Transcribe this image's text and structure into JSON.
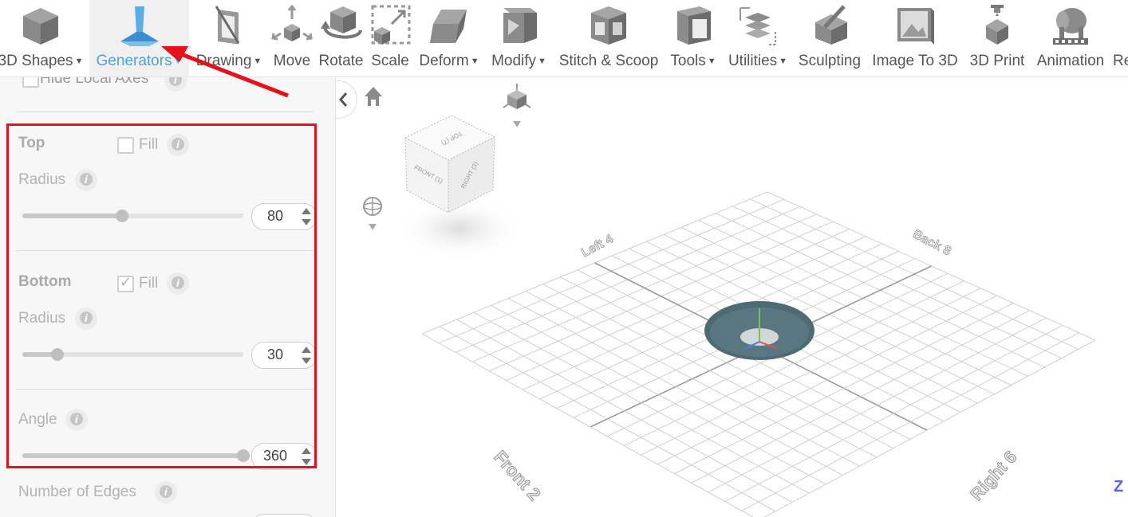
{
  "toolbar": {
    "items": [
      {
        "label": "3D Shapes",
        "icon": "cube-icon",
        "dropdown": true
      },
      {
        "label": "Generators",
        "icon": "generator-icon",
        "dropdown": true,
        "active": true
      },
      {
        "label": "Drawing",
        "icon": "drawing-icon",
        "dropdown": true
      },
      {
        "label": "Move",
        "icon": "move-icon",
        "dropdown": false
      },
      {
        "label": "Rotate",
        "icon": "rotate-icon",
        "dropdown": false
      },
      {
        "label": "Scale",
        "icon": "scale-icon",
        "dropdown": false
      },
      {
        "label": "Deform",
        "icon": "deform-icon",
        "dropdown": true
      },
      {
        "label": "Modify",
        "icon": "modify-icon",
        "dropdown": true
      },
      {
        "label": "Stitch & Scoop",
        "icon": "stitch-scoop-icon",
        "dropdown": false
      },
      {
        "label": "Tools",
        "icon": "tools-icon",
        "dropdown": true
      },
      {
        "label": "Utilities",
        "icon": "utilities-icon",
        "dropdown": true
      },
      {
        "label": "Sculpting",
        "icon": "sculpting-icon",
        "dropdown": false
      },
      {
        "label": "Image To 3D",
        "icon": "image-to-3d-icon",
        "dropdown": false
      },
      {
        "label": "3D Print",
        "icon": "3d-print-icon",
        "dropdown": false
      },
      {
        "label": "Animation",
        "icon": "animation-icon",
        "dropdown": false
      },
      {
        "label": "Re",
        "icon": "",
        "dropdown": false
      }
    ]
  },
  "panel": {
    "hide_local_axes": "Hide Local Axes",
    "top": {
      "title": "Top",
      "fill_label": "Fill",
      "fill_checked": false,
      "radius_label": "Radius",
      "radius_value": "80",
      "slider_fraction": 0.45
    },
    "bottom": {
      "title": "Bottom",
      "fill_label": "Fill",
      "fill_checked": true,
      "radius_label": "Radius",
      "radius_value": "30",
      "slider_fraction": 0.16
    },
    "angle": {
      "label": "Angle",
      "value": "360",
      "slider_fraction": 1.0
    },
    "edges": {
      "label": "Number of Edges"
    }
  },
  "viewport": {
    "view_cube": {
      "top": "TOP (7)",
      "front": "FRONT (1)",
      "right": "RIGHT (3)"
    },
    "ground_labels": {
      "back": "Back 8",
      "left": "Left 4",
      "front": "Front 2",
      "right": "Right 6"
    },
    "axis_corner": "Z"
  },
  "colors": {
    "accent": "#4aa3df",
    "highlight_box": "#e8101a",
    "arrow": "#e8101a",
    "shape": "#4e6a72"
  }
}
